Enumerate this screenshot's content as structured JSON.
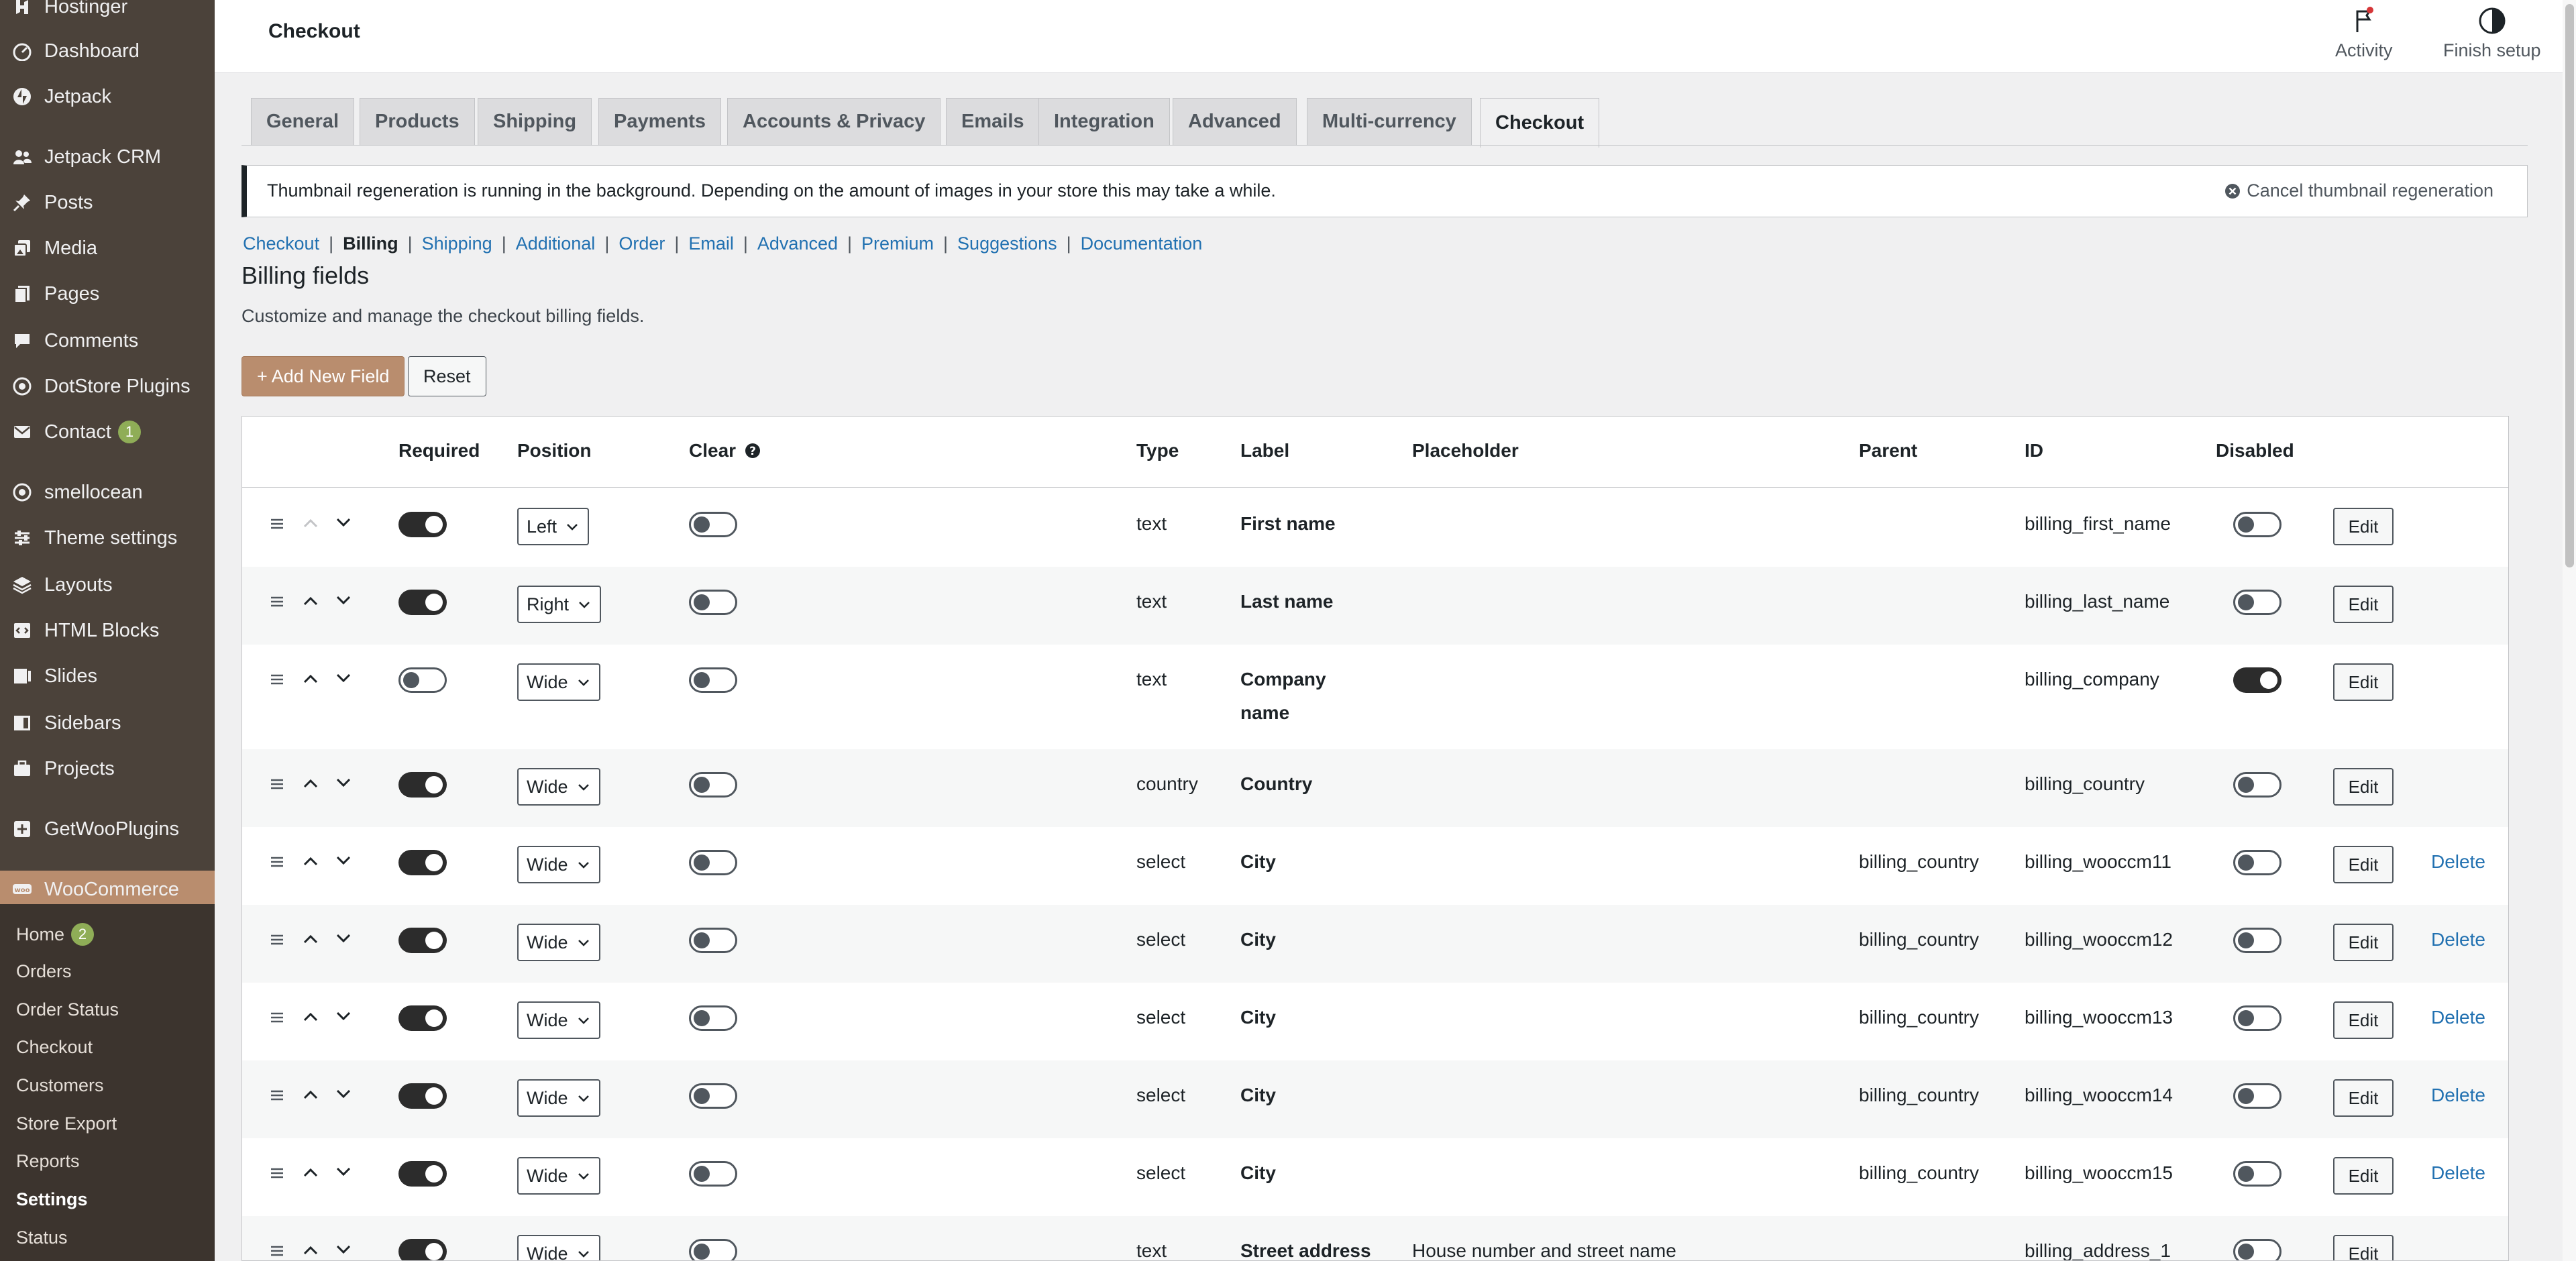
{
  "sidebar": {
    "items": [
      {
        "label": "Hostinger",
        "icon": "hostinger-icon"
      },
      {
        "label": "Dashboard",
        "icon": "dashboard-icon"
      },
      {
        "label": "Jetpack",
        "icon": "jetpack-icon"
      },
      {
        "label": "Jetpack CRM",
        "icon": "crm-icon"
      },
      {
        "label": "Posts",
        "icon": "pin-icon"
      },
      {
        "label": "Media",
        "icon": "media-icon"
      },
      {
        "label": "Pages",
        "icon": "pages-icon"
      },
      {
        "label": "Comments",
        "icon": "comment-icon"
      },
      {
        "label": "DotStore Plugins",
        "icon": "plugin-icon"
      },
      {
        "label": "Contact",
        "icon": "mail-icon",
        "badge": "1"
      },
      {
        "label": "smellocean",
        "icon": "smellocean-icon"
      },
      {
        "label": "Theme settings",
        "icon": "sliders-icon"
      },
      {
        "label": "Layouts",
        "icon": "layers-icon"
      },
      {
        "label": "HTML Blocks",
        "icon": "code-icon"
      },
      {
        "label": "Slides",
        "icon": "slides-icon"
      },
      {
        "label": "Sidebars",
        "icon": "sidebar-icon"
      },
      {
        "label": "Projects",
        "icon": "briefcase-icon"
      },
      {
        "label": "GetWooPlugins",
        "icon": "plus-box-icon"
      },
      {
        "label": "WooCommerce",
        "icon": "woo-icon"
      }
    ],
    "submenu": [
      {
        "label": "Home",
        "badge": "2"
      },
      {
        "label": "Orders"
      },
      {
        "label": "Order Status"
      },
      {
        "label": "Checkout"
      },
      {
        "label": "Customers"
      },
      {
        "label": "Store Export"
      },
      {
        "label": "Reports"
      },
      {
        "label": "Settings"
      },
      {
        "label": "Status"
      }
    ]
  },
  "header": {
    "title": "Checkout",
    "activity_label": "Activity",
    "finish_setup_label": "Finish setup"
  },
  "tabs": [
    "General",
    "Products",
    "Shipping",
    "Payments",
    "Accounts & Privacy",
    "Emails",
    "Integration",
    "Advanced",
    "Multi-currency",
    "Checkout"
  ],
  "notice": {
    "message": "Thumbnail regeneration is running in the background. Depending on the amount of images in your store this may take a while.",
    "cancel_label": "Cancel thumbnail regeneration"
  },
  "subnav": [
    "Checkout",
    "Billing",
    "Shipping",
    "Additional",
    "Order",
    "Email",
    "Advanced",
    "Premium",
    "Suggestions",
    "Documentation"
  ],
  "section": {
    "title": "Billing fields",
    "description": "Customize and manage the checkout billing fields."
  },
  "buttons": {
    "add_new_field": "+ Add New Field",
    "reset": "Reset",
    "edit": "Edit",
    "delete": "Delete"
  },
  "table": {
    "headers": {
      "required": "Required",
      "position": "Position",
      "clear": "Clear",
      "type": "Type",
      "label": "Label",
      "placeholder": "Placeholder",
      "parent": "Parent",
      "id": "ID",
      "disabled": "Disabled"
    },
    "rows": [
      {
        "required": true,
        "position": "Left",
        "clear": false,
        "type": "text",
        "label": "First name",
        "placeholder": "",
        "parent": "",
        "id": "billing_first_name",
        "disabled": false,
        "deletable": false
      },
      {
        "required": true,
        "position": "Right",
        "clear": false,
        "type": "text",
        "label": "Last name",
        "placeholder": "",
        "parent": "",
        "id": "billing_last_name",
        "disabled": false,
        "deletable": false
      },
      {
        "required": false,
        "position": "Wide",
        "clear": false,
        "type": "text",
        "label": "Company name",
        "label_lines": [
          "Company",
          "name"
        ],
        "placeholder": "",
        "parent": "",
        "id": "billing_company",
        "disabled": true,
        "deletable": false
      },
      {
        "required": true,
        "position": "Wide",
        "clear": false,
        "type": "country",
        "label": "Country",
        "placeholder": "",
        "parent": "",
        "id": "billing_country",
        "disabled": false,
        "deletable": false
      },
      {
        "required": true,
        "position": "Wide",
        "clear": false,
        "type": "select",
        "label": "City",
        "placeholder": "",
        "parent": "billing_country",
        "id": "billing_wooccm11",
        "disabled": false,
        "deletable": true
      },
      {
        "required": true,
        "position": "Wide",
        "clear": false,
        "type": "select",
        "label": "City",
        "placeholder": "",
        "parent": "billing_country",
        "id": "billing_wooccm12",
        "disabled": false,
        "deletable": true
      },
      {
        "required": true,
        "position": "Wide",
        "clear": false,
        "type": "select",
        "label": "City",
        "placeholder": "",
        "parent": "billing_country",
        "id": "billing_wooccm13",
        "disabled": false,
        "deletable": true
      },
      {
        "required": true,
        "position": "Wide",
        "clear": false,
        "type": "select",
        "label": "City",
        "placeholder": "",
        "parent": "billing_country",
        "id": "billing_wooccm14",
        "disabled": false,
        "deletable": true
      },
      {
        "required": true,
        "position": "Wide",
        "clear": false,
        "type": "select",
        "label": "City",
        "placeholder": "",
        "parent": "billing_country",
        "id": "billing_wooccm15",
        "disabled": false,
        "deletable": true
      },
      {
        "required": true,
        "position": "Wide",
        "clear": false,
        "type": "text",
        "label": "Street address",
        "placeholder": "House number and street name",
        "parent": "",
        "id": "billing_address_1",
        "disabled": false,
        "deletable": false
      }
    ]
  },
  "colors": {
    "sidebar_bg": "#4b423a",
    "active_menu": "#b98d6e",
    "link": "#2271b1",
    "badge": "#8fad57"
  }
}
